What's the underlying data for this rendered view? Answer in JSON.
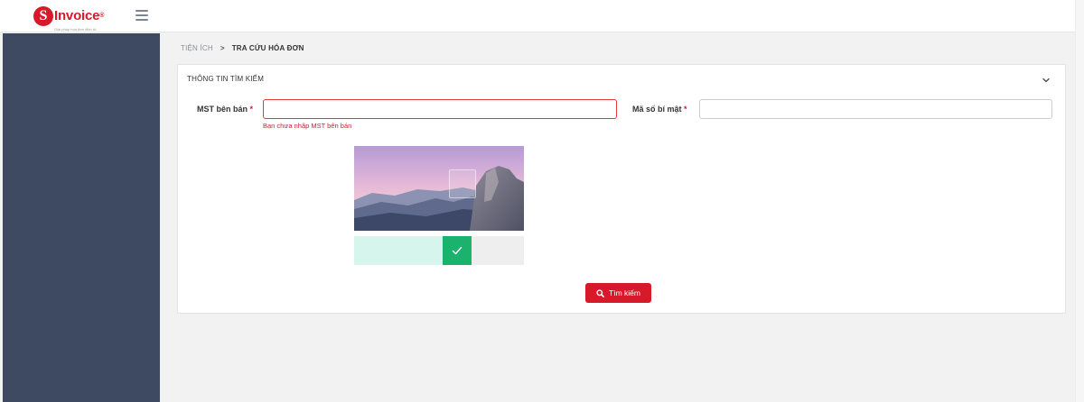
{
  "header": {
    "logo_letter": "S",
    "logo_text": "Invoice",
    "logo_mark": "®",
    "logo_tagline": "Giải pháp hóa đơn điện tử"
  },
  "breadcrumb": {
    "parent": "TIỆN ÍCH",
    "separator": ">",
    "current": "TRA CỨU HÓA ĐƠN"
  },
  "panel": {
    "title": "THÔNG TIN TÌM KIẾM"
  },
  "form": {
    "seller_tax_label": "MST bên bán",
    "seller_tax_required": "*",
    "seller_tax_value": "",
    "seller_tax_error": "Bạn chưa nhập MST bên bán",
    "secret_code_label": "Mã số bí mật",
    "secret_code_required": "*",
    "secret_code_value": ""
  },
  "captcha": {
    "slider_progress": 0.63,
    "status": "verified"
  },
  "search_button": {
    "label": "Tìm kiếm"
  },
  "colors": {
    "brand": "#d7192a",
    "sidebar": "#3d4a61",
    "success": "#1bb26d",
    "slider_fill": "#d6f5ec",
    "error": "#e53935"
  },
  "icons": {
    "menu": "hamburger-icon",
    "collapse": "chevron-down-icon",
    "slider_status": "check-icon",
    "search": "search-icon"
  }
}
